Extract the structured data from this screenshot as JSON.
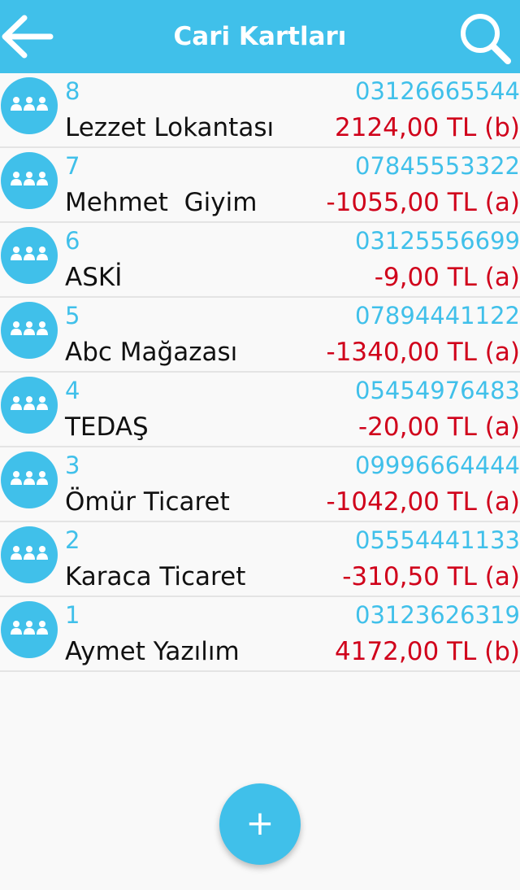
{
  "app_bar": {
    "title": "Cari Kartları",
    "back_icon": "arrow-left-icon",
    "search_icon": "search-icon"
  },
  "colors": {
    "primary": "#40c0ea",
    "balance_text": "#d0021b",
    "name_text": "#111111"
  },
  "cards": [
    {
      "code": "8",
      "name": "Lezzet Lokantası",
      "phone": "03126665544",
      "balance": "2124,00 TL (b)"
    },
    {
      "code": "7",
      "name": "Mehmet  Giyim",
      "phone": "07845553322",
      "balance": "-1055,00 TL (a)"
    },
    {
      "code": "6",
      "name": "ASKİ",
      "phone": "03125556699",
      "balance": "-9,00 TL (a)"
    },
    {
      "code": "5",
      "name": "Abc Mağazası",
      "phone": "07894441122",
      "balance": "-1340,00 TL (a)"
    },
    {
      "code": "4",
      "name": "TEDAŞ",
      "phone": "05454976483",
      "balance": "-20,00 TL (a)"
    },
    {
      "code": "3",
      "name": "Ömür Ticaret",
      "phone": "09996664444",
      "balance": "-1042,00 TL (a)"
    },
    {
      "code": "2",
      "name": "Karaca Ticaret",
      "phone": "05554441133",
      "balance": "-310,50 TL (a)"
    },
    {
      "code": "1",
      "name": "Aymet Yazılım",
      "phone": "03123626319",
      "balance": "4172,00 TL (b)"
    }
  ],
  "fab": {
    "label": "+",
    "icon": "plus-icon"
  }
}
